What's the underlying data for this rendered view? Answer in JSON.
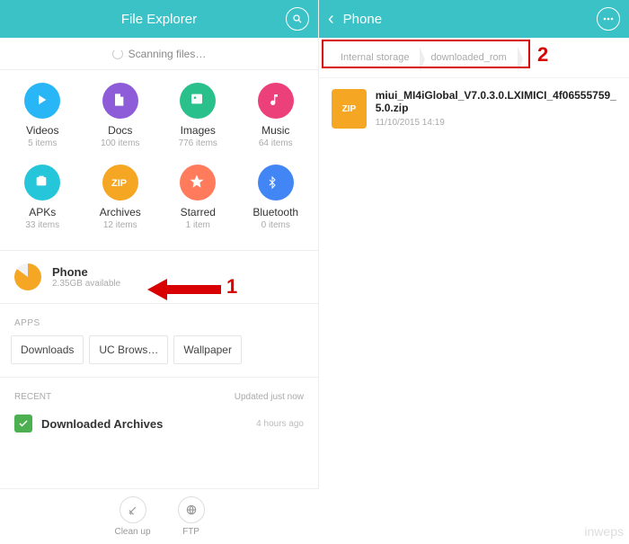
{
  "left_header": {
    "title": "File Explorer"
  },
  "scanning_text": "Scanning files…",
  "categories": [
    {
      "name": "Videos",
      "count": "5 items",
      "color": "#29b6f6"
    },
    {
      "name": "Docs",
      "count": "100 items",
      "color": "#8e5cd9"
    },
    {
      "name": "Images",
      "count": "776 items",
      "color": "#29c08b"
    },
    {
      "name": "Music",
      "count": "64 items",
      "color": "#ec407a"
    },
    {
      "name": "APKs",
      "count": "33 items",
      "color": "#26c6da"
    },
    {
      "name": "Archives",
      "count": "12 items",
      "color": "#f5a623"
    },
    {
      "name": "Starred",
      "count": "1 item",
      "color": "#ff7b5c"
    },
    {
      "name": "Bluetooth",
      "count": "0 items",
      "color": "#4285f4"
    }
  ],
  "storage": {
    "name": "Phone",
    "sub": "2.35GB available"
  },
  "sections": {
    "apps": "APPS",
    "recent": "RECENT",
    "updated": "Updated just now"
  },
  "apps": [
    "Downloads",
    "UC Brows…",
    "Wallpaper"
  ],
  "recent_item": {
    "title": "Downloaded Archives",
    "time": "4 hours ago"
  },
  "bottom": {
    "cleanup": "Clean up",
    "ftp": "FTP"
  },
  "right_header": {
    "title": "Phone"
  },
  "breadcrumb": [
    "Internal storage",
    "downloaded_rom"
  ],
  "file": {
    "name": "miui_MI4iGlobal_V7.0.3.0.LXIMICI_4f06555759_5.0.zip",
    "badge": "ZIP",
    "meta": "11/10/2015 14:19"
  },
  "annotations": {
    "one": "1",
    "two": "2"
  },
  "watermark": "inweps"
}
